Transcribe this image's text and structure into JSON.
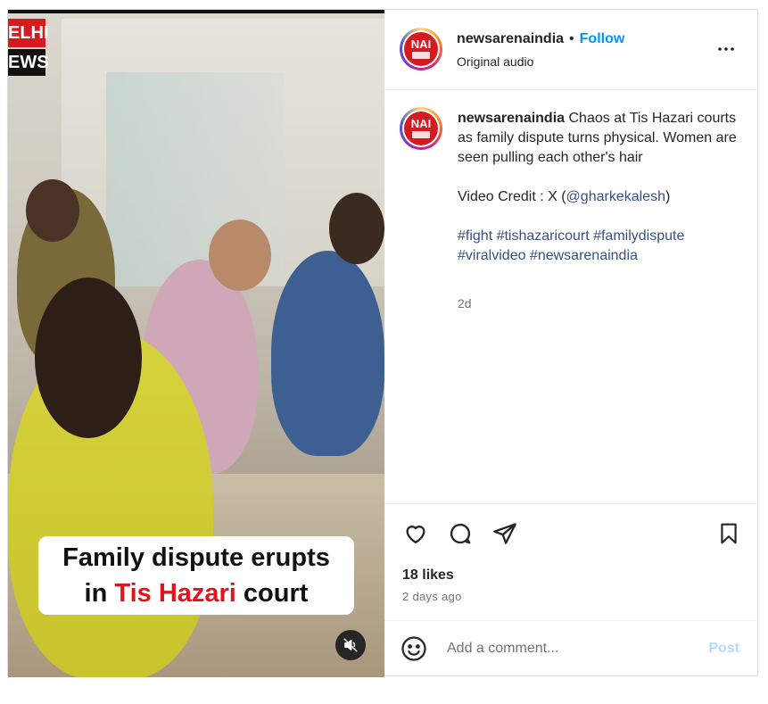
{
  "video": {
    "channel_logo_line1": "ELHI",
    "channel_logo_line2": "EWS",
    "caption_part1": "Family dispute erupts",
    "caption_part2_prefix": "in ",
    "caption_highlight": "Tis Hazari",
    "caption_part2_suffix": " court",
    "mute_icon": "speaker-muted-icon"
  },
  "header": {
    "avatar_text": "NAI",
    "username": "newsarenaindia",
    "separator": "•",
    "follow_label": "Follow",
    "audio": "Original audio",
    "more_icon": "more-horizontal-icon"
  },
  "comment": {
    "avatar_text": "NAI",
    "username": "newsarenaindia",
    "text": "Chaos at Tis Hazari courts as family dispute turns physical. Women are seen pulling each other's hair",
    "credit_prefix": "Video Credit : X (",
    "credit_handle": "@gharkekalesh",
    "credit_suffix": ")",
    "hashtags_line1": "#fight #tishazaricourt #familydispute",
    "hashtags_line2": "#viralvideo #newsarenaindia",
    "age": "2d"
  },
  "actions": {
    "like_icon": "heart-icon",
    "comment_icon": "comment-bubble-icon",
    "share_icon": "paper-plane-icon",
    "save_icon": "bookmark-icon",
    "likes": "18 likes",
    "posted": "2 days ago"
  },
  "add_comment": {
    "emoji_icon": "smiley-icon",
    "placeholder": "Add a comment...",
    "post_label": "Post"
  },
  "colors": {
    "accent": "#0095f6",
    "brand_red": "#d71920",
    "hashtag": "#385185",
    "post_disabled": "#b3dbff"
  }
}
